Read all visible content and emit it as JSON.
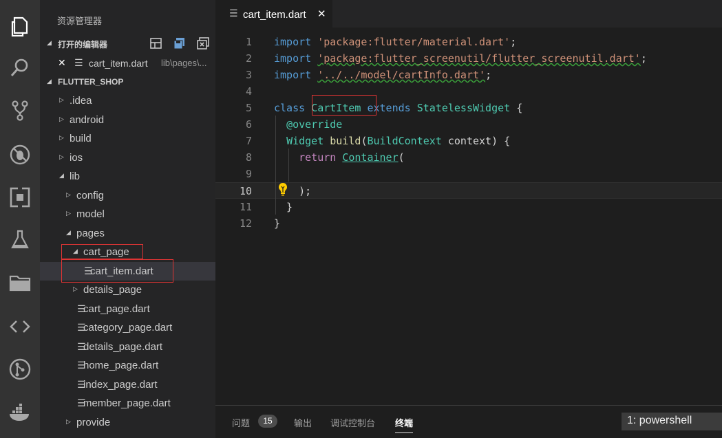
{
  "activity_bar": {
    "items": [
      {
        "name": "explorer-icon"
      },
      {
        "name": "search-icon"
      },
      {
        "name": "source-control-icon"
      },
      {
        "name": "debug-icon"
      },
      {
        "name": "extensions-icon"
      },
      {
        "name": "test-icon"
      },
      {
        "name": "folder-icon"
      },
      {
        "name": "code-icon"
      },
      {
        "name": "git-graph-icon"
      },
      {
        "name": "docker-icon"
      }
    ]
  },
  "sidebar": {
    "title": "资源管理器",
    "open_editors": {
      "label": "打开的编辑器",
      "item": {
        "close": "✕",
        "name": "cart_item.dart",
        "path": "lib\\pages\\..."
      }
    },
    "project": {
      "label": "FLUTTER_SHOP"
    },
    "tree": [
      {
        "label": ".idea",
        "type": "folder",
        "expanded": false,
        "depth": 0
      },
      {
        "label": "android",
        "type": "folder",
        "expanded": false,
        "depth": 0
      },
      {
        "label": "build",
        "type": "folder",
        "expanded": false,
        "depth": 0
      },
      {
        "label": "ios",
        "type": "folder",
        "expanded": false,
        "depth": 0
      },
      {
        "label": "lib",
        "type": "folder",
        "expanded": true,
        "depth": 0
      },
      {
        "label": "config",
        "type": "folder",
        "expanded": false,
        "depth": 1
      },
      {
        "label": "model",
        "type": "folder",
        "expanded": false,
        "depth": 1
      },
      {
        "label": "pages",
        "type": "folder",
        "expanded": true,
        "depth": 1
      },
      {
        "label": "cart_page",
        "type": "folder",
        "expanded": true,
        "depth": 2
      },
      {
        "label": "cart_item.dart",
        "type": "file",
        "depth": 3,
        "selected": true
      },
      {
        "label": "details_page",
        "type": "folder",
        "expanded": false,
        "depth": 2
      },
      {
        "label": "cart_page.dart",
        "type": "file",
        "depth": 2
      },
      {
        "label": "category_page.dart",
        "type": "file",
        "depth": 2
      },
      {
        "label": "details_page.dart",
        "type": "file",
        "depth": 2
      },
      {
        "label": "home_page.dart",
        "type": "file",
        "depth": 2
      },
      {
        "label": "index_page.dart",
        "type": "file",
        "depth": 2
      },
      {
        "label": "member_page.dart",
        "type": "file",
        "depth": 2
      },
      {
        "label": "provide",
        "type": "folder",
        "expanded": false,
        "depth": 1
      }
    ]
  },
  "editor": {
    "tab": {
      "name": "cart_item.dart",
      "close": "✕"
    },
    "current_line": 10,
    "lines": [
      {
        "n": "1",
        "tokens": [
          {
            "t": "import",
            "c": "kw"
          },
          {
            "t": " ",
            "c": "plain"
          },
          {
            "t": "'package:flutter/material.dart'",
            "c": "str"
          },
          {
            "t": ";",
            "c": "plain"
          }
        ]
      },
      {
        "n": "2",
        "tokens": [
          {
            "t": "import",
            "c": "kw"
          },
          {
            "t": " ",
            "c": "plain"
          },
          {
            "t": "'package:flutter_screenutil/flutter_screenutil.dart'",
            "c": "str squig"
          },
          {
            "t": ";",
            "c": "plain"
          }
        ]
      },
      {
        "n": "3",
        "tokens": [
          {
            "t": "import",
            "c": "kw"
          },
          {
            "t": " ",
            "c": "plain"
          },
          {
            "t": "'../../model/cartInfo.dart'",
            "c": "str squig"
          },
          {
            "t": ";",
            "c": "plain"
          }
        ]
      },
      {
        "n": "4",
        "tokens": []
      },
      {
        "n": "5",
        "tokens": [
          {
            "t": "class",
            "c": "kw"
          },
          {
            "t": " ",
            "c": "plain"
          },
          {
            "t": "CartItem",
            "c": "typ"
          },
          {
            "t": " ",
            "c": "plain"
          },
          {
            "t": "extends",
            "c": "kw"
          },
          {
            "t": " ",
            "c": "plain"
          },
          {
            "t": "StatelessWidget",
            "c": "typ"
          },
          {
            "t": " {",
            "c": "plain"
          }
        ]
      },
      {
        "n": "6",
        "tokens": [
          {
            "t": "  ",
            "c": "plain"
          },
          {
            "t": "@override",
            "c": "deco"
          }
        ]
      },
      {
        "n": "7",
        "tokens": [
          {
            "t": "  ",
            "c": "plain"
          },
          {
            "t": "Widget",
            "c": "typ"
          },
          {
            "t": " ",
            "c": "plain"
          },
          {
            "t": "build",
            "c": "fn"
          },
          {
            "t": "(",
            "c": "plain"
          },
          {
            "t": "BuildContext",
            "c": "typ"
          },
          {
            "t": " context) {",
            "c": "plain"
          }
        ]
      },
      {
        "n": "8",
        "tokens": [
          {
            "t": "    ",
            "c": "plain"
          },
          {
            "t": "return",
            "c": "kw2"
          },
          {
            "t": " ",
            "c": "plain"
          },
          {
            "t": "Container",
            "c": "typ link"
          },
          {
            "t": "(",
            "c": "plain"
          }
        ]
      },
      {
        "n": "9",
        "tokens": []
      },
      {
        "n": "10",
        "tokens": [
          {
            "t": "    );",
            "c": "plain"
          }
        ]
      },
      {
        "n": "11",
        "tokens": [
          {
            "t": "  }",
            "c": "plain"
          }
        ]
      },
      {
        "n": "12",
        "tokens": [
          {
            "t": "}",
            "c": "plain"
          }
        ]
      }
    ]
  },
  "panel": {
    "tabs": [
      {
        "label": "问题",
        "active": false
      },
      {
        "label": "输出",
        "active": false
      },
      {
        "label": "调试控制台",
        "active": false
      },
      {
        "label": "终端",
        "active": true
      }
    ],
    "problems_count": "15",
    "terminal_select": "1: powershell"
  },
  "colors": {
    "accent_red": "#e03434",
    "activity_bg": "#333333",
    "sidebar_bg": "#252526",
    "editor_bg": "#1e1e1e"
  }
}
